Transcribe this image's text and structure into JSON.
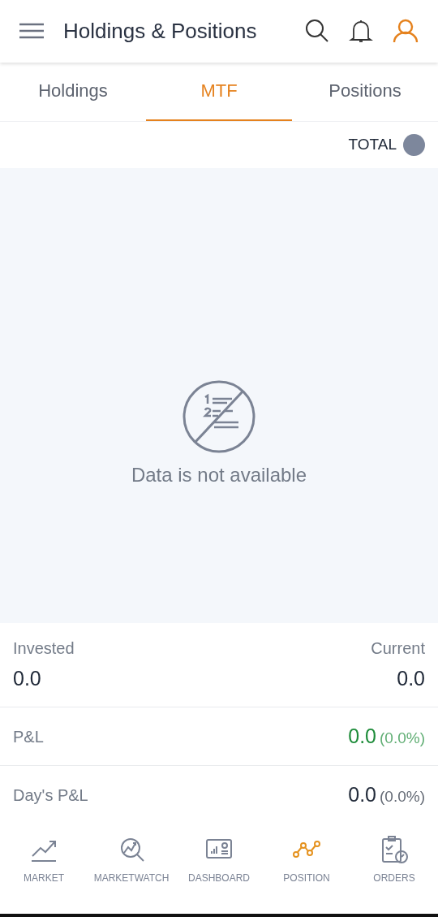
{
  "header": {
    "title": "Holdings & Positions"
  },
  "tabs": [
    {
      "label": "Holdings",
      "selected": false
    },
    {
      "label": "MTF",
      "selected": true
    },
    {
      "label": "Positions",
      "selected": false
    }
  ],
  "total_label": "TOTAL",
  "empty_state": {
    "message": "Data is not available"
  },
  "summary": {
    "invested": {
      "label": "Invested",
      "value": "0.0"
    },
    "current": {
      "label": "Current",
      "value": "0.0"
    },
    "rows": [
      {
        "label": "P&L",
        "value": "0.0",
        "percent": "(0.0%)",
        "color": "#1e8c3a"
      },
      {
        "label": "Day's P&L",
        "value": "0.0",
        "percent": "(0.0%)",
        "color": "#222b3a"
      }
    ]
  },
  "bottom_nav": [
    {
      "kind": "market",
      "label": "MARKET",
      "selected": false
    },
    {
      "kind": "marketwatch",
      "label": "MARKETWATCH",
      "selected": false
    },
    {
      "kind": "dashboard",
      "label": "DASHBOARD",
      "selected": false
    },
    {
      "kind": "position",
      "label": "POSITION",
      "selected": true
    },
    {
      "kind": "orders",
      "label": "ORDERS",
      "selected": false
    }
  ]
}
